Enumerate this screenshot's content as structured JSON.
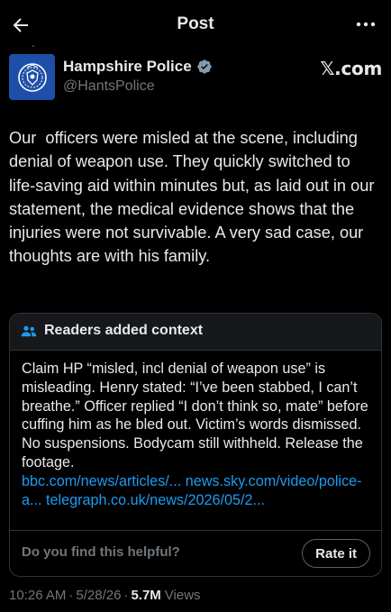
{
  "header": {
    "title": "Post",
    "back_icon": "arrow-left-icon",
    "more_icon": "more-horizontal-icon"
  },
  "author": {
    "name": "Hampshire Police",
    "handle": "@HantsPolice",
    "verified": true,
    "avatar_icon": "police-crest-icon",
    "avatar_color": "#1d4fa8",
    "verified_color": "#829aab"
  },
  "source_label": "𝕏.com",
  "post": {
    "text": "Our  officers were misled at the scene, including denial of weapon use. They quickly switched to life-saving aid within minutes but, as laid out in our statement, the medical evidence shows that the injuries were not survivable. A very sad case, our thoughts are with his family."
  },
  "community_note": {
    "header": "Readers added context",
    "icon": "people-icon",
    "body": "Claim HP “misled, incl denial of weapon use” is misleading. Henry stated: “I’ve been stabbed, I can’t breathe.” Officer replied “I don’t think so, mate” before cuffing him as he bled out. Victim’s words dismissed. No suspensions. Bodycam still withheld. Release the footage.",
    "links": [
      "bbc.com/news/articles/...",
      "news.sky.com/video/police-a...",
      "telegraph.co.uk/news/2026/05/2..."
    ],
    "footer_question": "Do you find this helpful?",
    "rate_label": "Rate it",
    "link_color": "#1d9bf0"
  },
  "meta": {
    "time": "10:26 AM",
    "separator": "·",
    "date": "5/28/26",
    "views_count": "5.7M",
    "views_label": "Views"
  },
  "colors": {
    "background": "#000000",
    "text": "#e7e9ea",
    "muted": "#71767b",
    "border": "#2f3336"
  }
}
